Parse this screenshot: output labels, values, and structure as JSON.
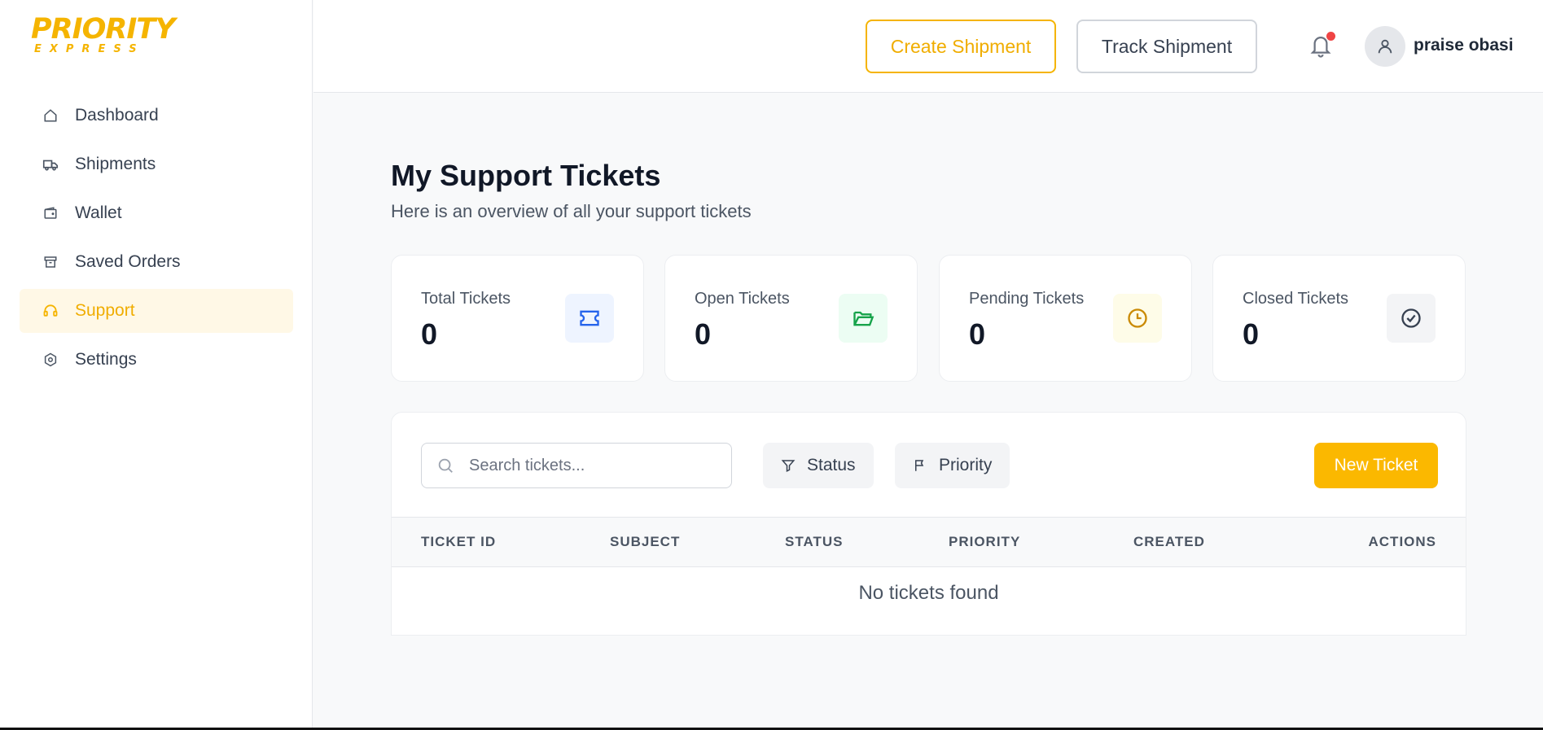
{
  "brand": {
    "logo_main": "PRIORITY",
    "logo_sub": "EXPRESS",
    "accent": "#f5b400"
  },
  "sidebar": {
    "items": [
      {
        "label": "Dashboard",
        "icon": "home-icon",
        "active": false
      },
      {
        "label": "Shipments",
        "icon": "truck-icon",
        "active": false
      },
      {
        "label": "Wallet",
        "icon": "wallet-icon",
        "active": false
      },
      {
        "label": "Saved Orders",
        "icon": "archive-icon",
        "active": false
      },
      {
        "label": "Support",
        "icon": "headset-icon",
        "active": true
      },
      {
        "label": "Settings",
        "icon": "settings-icon",
        "active": false
      }
    ]
  },
  "header": {
    "create_label": "Create Shipment",
    "track_label": "Track Shipment",
    "notifications_icon": "bell-icon",
    "user_name": "praise obasi"
  },
  "page": {
    "title": "My Support Tickets",
    "subtitle": "Here is an overview of all your support tickets"
  },
  "stats": [
    {
      "label": "Total Tickets",
      "value": "0",
      "icon": "ticket-icon",
      "color": "#2563eb",
      "bg": "#eef4ff"
    },
    {
      "label": "Open Tickets",
      "value": "0",
      "icon": "folder-open-icon",
      "color": "#16a34a",
      "bg": "#ecfdf3"
    },
    {
      "label": "Pending Tickets",
      "value": "0",
      "icon": "clock-icon",
      "color": "#ca8a04",
      "bg": "#fefce8"
    },
    {
      "label": "Closed Tickets",
      "value": "0",
      "icon": "check-circle-icon",
      "color": "#374151",
      "bg": "#f3f4f6"
    }
  ],
  "toolbar": {
    "search_placeholder": "Search tickets...",
    "status_label": "Status",
    "priority_label": "Priority",
    "new_ticket_label": "New Ticket"
  },
  "table": {
    "columns": [
      "TICKET ID",
      "SUBJECT",
      "STATUS",
      "PRIORITY",
      "CREATED",
      "ACTIONS"
    ],
    "empty_message": "No tickets found"
  }
}
